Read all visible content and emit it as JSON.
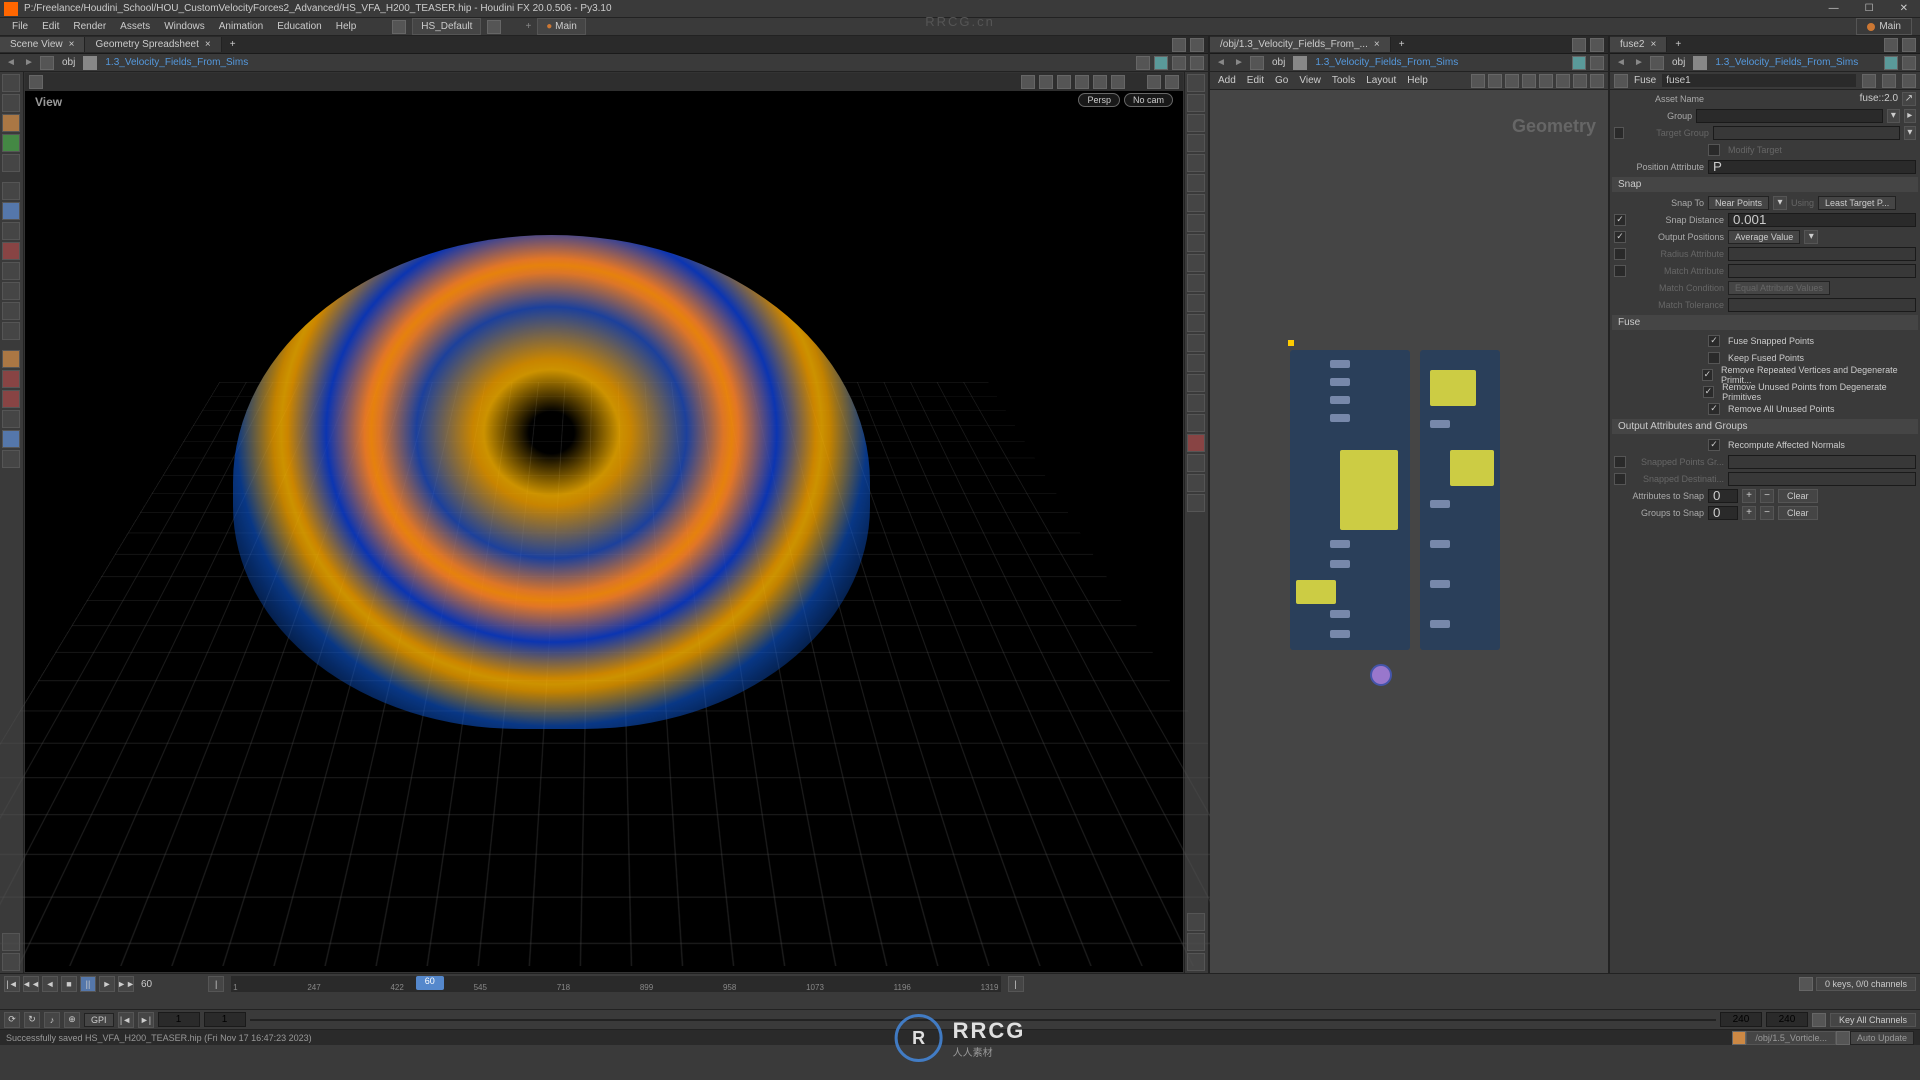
{
  "title_bar": {
    "title": "P:/Freelance/Houdini_School/HOU_CustomVelocityForces2_Advanced/HS_VFA_H200_TEASER.hip - Houdini FX 20.0.506 - Py3.10"
  },
  "menu": {
    "items": [
      "File",
      "Edit",
      "Render",
      "Assets",
      "Windows",
      "Animation",
      "Education",
      "Help"
    ],
    "shelf": "HS_Default",
    "desktop": "Main",
    "desktop2": "Main"
  },
  "left_tabs": {
    "scene": "Scene View",
    "geo": "Geometry Spreadsheet"
  },
  "viewport": {
    "path_root": "obj",
    "path_node": "1.3_Velocity_Fields_From_Sims",
    "label": "View",
    "persp": "Persp",
    "cam": "No cam"
  },
  "network": {
    "tab": "/obj/1.3_Velocity_Fields_From_...",
    "path_root": "obj",
    "path_node": "1.3_Velocity_Fields_From_Sims",
    "geo_label": "Geometry",
    "menus": [
      "Add",
      "Edit",
      "Go",
      "View",
      "Tools",
      "Layout",
      "Help"
    ]
  },
  "params": {
    "tab1": "fuse2",
    "path_root": "obj",
    "path_node": "1.3_Velocity_Fields_From_Sims",
    "node_type": "Fuse",
    "node_name": "fuse1",
    "asset_label": "Asset Name",
    "asset_name": "fuse::2.0",
    "group_label": "Group",
    "group_value": "",
    "target_group_label": "Target Group",
    "modify_target": "Modify Target",
    "position_attr_label": "Position Attribute",
    "position_attr": "P",
    "snap_section": "Snap",
    "snap_to_label": "Snap To",
    "snap_to": "Near Points",
    "using_label": "Using",
    "using": "Least Target P...",
    "snap_distance_label": "Snap Distance",
    "snap_distance": "0.001",
    "output_positions_label": "Output Positions",
    "output_positions": "Average Value",
    "radius_attr_label": "Radius Attribute",
    "match_attr_label": "Match Attribute",
    "match_condition_label": "Match Condition",
    "match_condition": "Equal Attribute Values",
    "match_tolerance_label": "Match Tolerance",
    "fuse_section": "Fuse",
    "fuse_snapped": "Fuse Snapped Points",
    "keep_fused": "Keep Fused Points",
    "remove_repeated": "Remove Repeated Vertices and Degenerate Primit...",
    "remove_unused": "Remove Unused Points from Degenerate Primitives",
    "remove_all": "Remove All Unused Points",
    "output_section": "Output Attributes and Groups",
    "recompute_normals": "Recompute Affected Normals",
    "snapped_points_label": "Snapped Points Gr...",
    "snapped_dest_label": "Snapped Destinati...",
    "attrs_snap_label": "Attributes to Snap",
    "attrs_snap_value": "0",
    "groups_snap_label": "Groups to Snap",
    "groups_snap_value": "0",
    "clear": "Clear"
  },
  "timeline": {
    "current": "60",
    "marks": [
      "1",
      "60",
      "247",
      "422",
      "545",
      "718",
      "899",
      "958",
      "1073",
      "1196",
      "1319"
    ],
    "start": "1",
    "end": "240",
    "end2": "240"
  },
  "anim_bar": {
    "mode": "GPI",
    "frame": "1",
    "keys_status": "0 keys, 0/0 channels",
    "key_all": "Key All Channels"
  },
  "status": {
    "msg": "Successfully saved HS_VFA_H200_TEASER.hip (Fri Nov 17 16:47:23 2023)",
    "pdg_path": "/obj/1.5_Vorticle...",
    "auto_update": "Auto Update"
  },
  "watermark": {
    "top": "RRCG.cn",
    "main": "RRCG",
    "sub": "人人素材"
  }
}
